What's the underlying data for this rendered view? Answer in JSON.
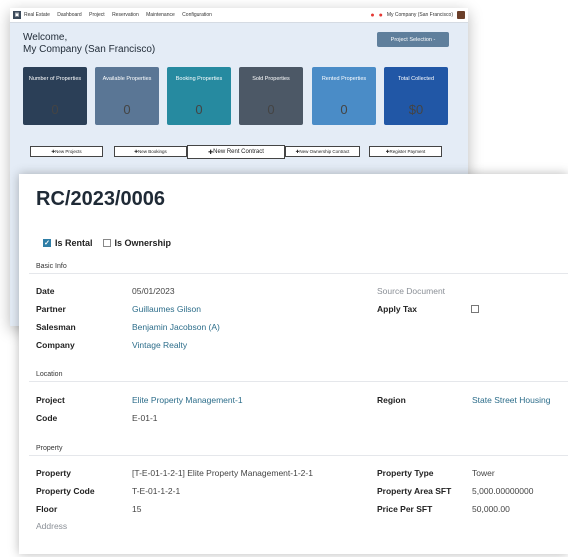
{
  "top_menu": {
    "app": "Real Estate",
    "items": [
      "Dashboard",
      "Project",
      "Reservation",
      "Maintenance",
      "Configuration"
    ],
    "company": "My Company (San Francisco)"
  },
  "dashboard": {
    "welcome_line1": "Welcome,",
    "welcome_line2": "My Company (San Francisco)",
    "project_selection": "Project Selection -",
    "cards": [
      {
        "label": "Number of Properties",
        "value": "0",
        "color": "#2b3f57"
      },
      {
        "label": "Available Properties",
        "value": "0",
        "color": "#5a7695"
      },
      {
        "label": "Booking Properties",
        "value": "0",
        "color": "#268aa0"
      },
      {
        "label": "Sold Properties",
        "value": "0",
        "color": "#4c5866"
      },
      {
        "label": "Rented Properties",
        "value": "0",
        "color": "#4a8cc7"
      },
      {
        "label": "Total Collected",
        "value": "$0",
        "color": "#2157a6"
      }
    ],
    "buttons": [
      "New Projects",
      "New Bookings",
      "New Rent Contract",
      "New Ownership Contract",
      "Register Payment"
    ]
  },
  "form": {
    "title": "RC/2023/0006",
    "is_rental": "Is Rental",
    "is_ownership": "Is Ownership",
    "sections": {
      "basic": "Basic Info",
      "location": "Location",
      "property": "Property"
    },
    "basic": {
      "date_label": "Date",
      "date": "05/01/2023",
      "partner_label": "Partner",
      "partner": "Guillaumes Gilson",
      "salesman_label": "Salesman",
      "salesman": "Benjamin Jacobson (A)",
      "company_label": "Company",
      "company": "Vintage Realty",
      "source_label": "Source Document",
      "tax_label": "Apply Tax"
    },
    "location": {
      "project_label": "Project",
      "project": "Elite Property Management-1",
      "code_label": "Code",
      "code": "E-01-1",
      "region_label": "Region",
      "region": "State Street Housing"
    },
    "property": {
      "property_label": "Property",
      "property": "[T-E-01-1-2-1] Elite Property Management-1-2-1",
      "code_label": "Property Code",
      "code": "T-E-01-1-2-1",
      "floor_label": "Floor",
      "floor": "15",
      "address_label": "Address",
      "type_label": "Property Type",
      "type": "Tower",
      "area_label": "Property Area SFT",
      "area": "5,000.00000000",
      "price_label": "Price Per SFT",
      "price": "50,000.00"
    }
  }
}
